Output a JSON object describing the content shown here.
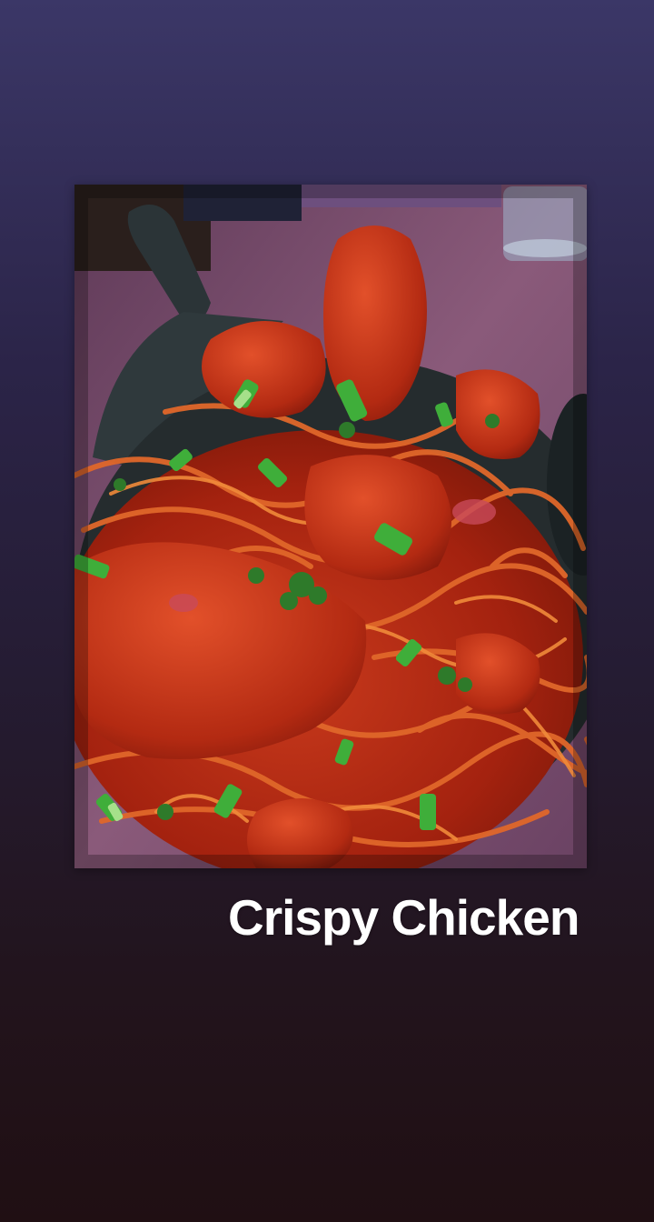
{
  "story": {
    "background_top_color": "#3b3767",
    "background_bottom_color": "#200f13",
    "caption": "Crispy Chicken",
    "caption_color": "#ffffff",
    "photo": {
      "subject": "chilli-chicken-noodles-photo"
    }
  }
}
